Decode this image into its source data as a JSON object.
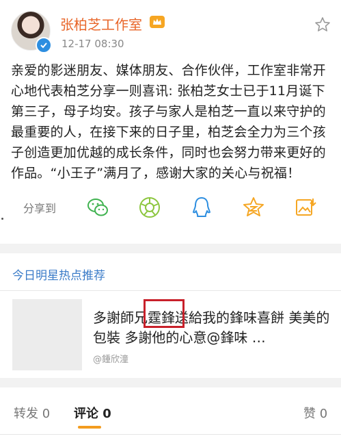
{
  "post": {
    "author": "张柏芝工作室",
    "time": "12-17 08:30",
    "text": "亲爱的影迷朋友、媒体朋友、合作伙伴，工作室非常开心地代表柏芝分享一则喜讯: 张柏芝女士已于11月诞下第三子，母子均安。孩子与家人是柏芝一直以来守护的最重要的人，在接下来的日子里，柏芝会全力为三个孩子创造更加优越的成长条件，同时也会努力带来更好的作品。“小王子”满月了，感谢大家的关心与祝福！"
  },
  "share": {
    "label": "分享到",
    "icons": [
      "wechat-icon",
      "moments-icon",
      "qq-icon",
      "qzone-icon",
      "save-image-icon"
    ]
  },
  "recommend": {
    "title": "今日明星热点推荐",
    "text": "多謝師兄霆鋒送給我的鋒味喜餅 美美的包裝 多謝他的心意@鋒味 …",
    "user": "@鍾欣潼"
  },
  "tabs": {
    "repost": "转发 0",
    "comment": "评论 0",
    "like": "赞 0"
  },
  "colors": {
    "author": "#e8662a",
    "link": "#3a7bc8",
    "share_green": "#3fb24f",
    "share_blue": "#2d8ee0",
    "share_orange": "#f5a623",
    "highlight": "#c8202a",
    "tab_underline": "#f39c1f"
  }
}
